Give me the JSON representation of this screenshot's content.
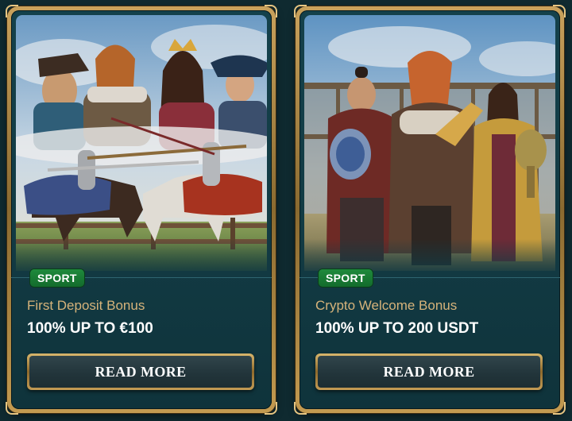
{
  "cards": [
    {
      "badge": "SPORT",
      "title": "First Deposit Bonus",
      "offer": "100% UP TO €100",
      "button": "READ MORE",
      "image": "jousting-knights-and-royals-illustration"
    },
    {
      "badge": "SPORT",
      "title": "Crypto Welcome Bonus",
      "offer": "100% UP TO 200 USDT",
      "button": "READ MORE",
      "image": "viking-warriors-with-trophies-illustration"
    }
  ]
}
